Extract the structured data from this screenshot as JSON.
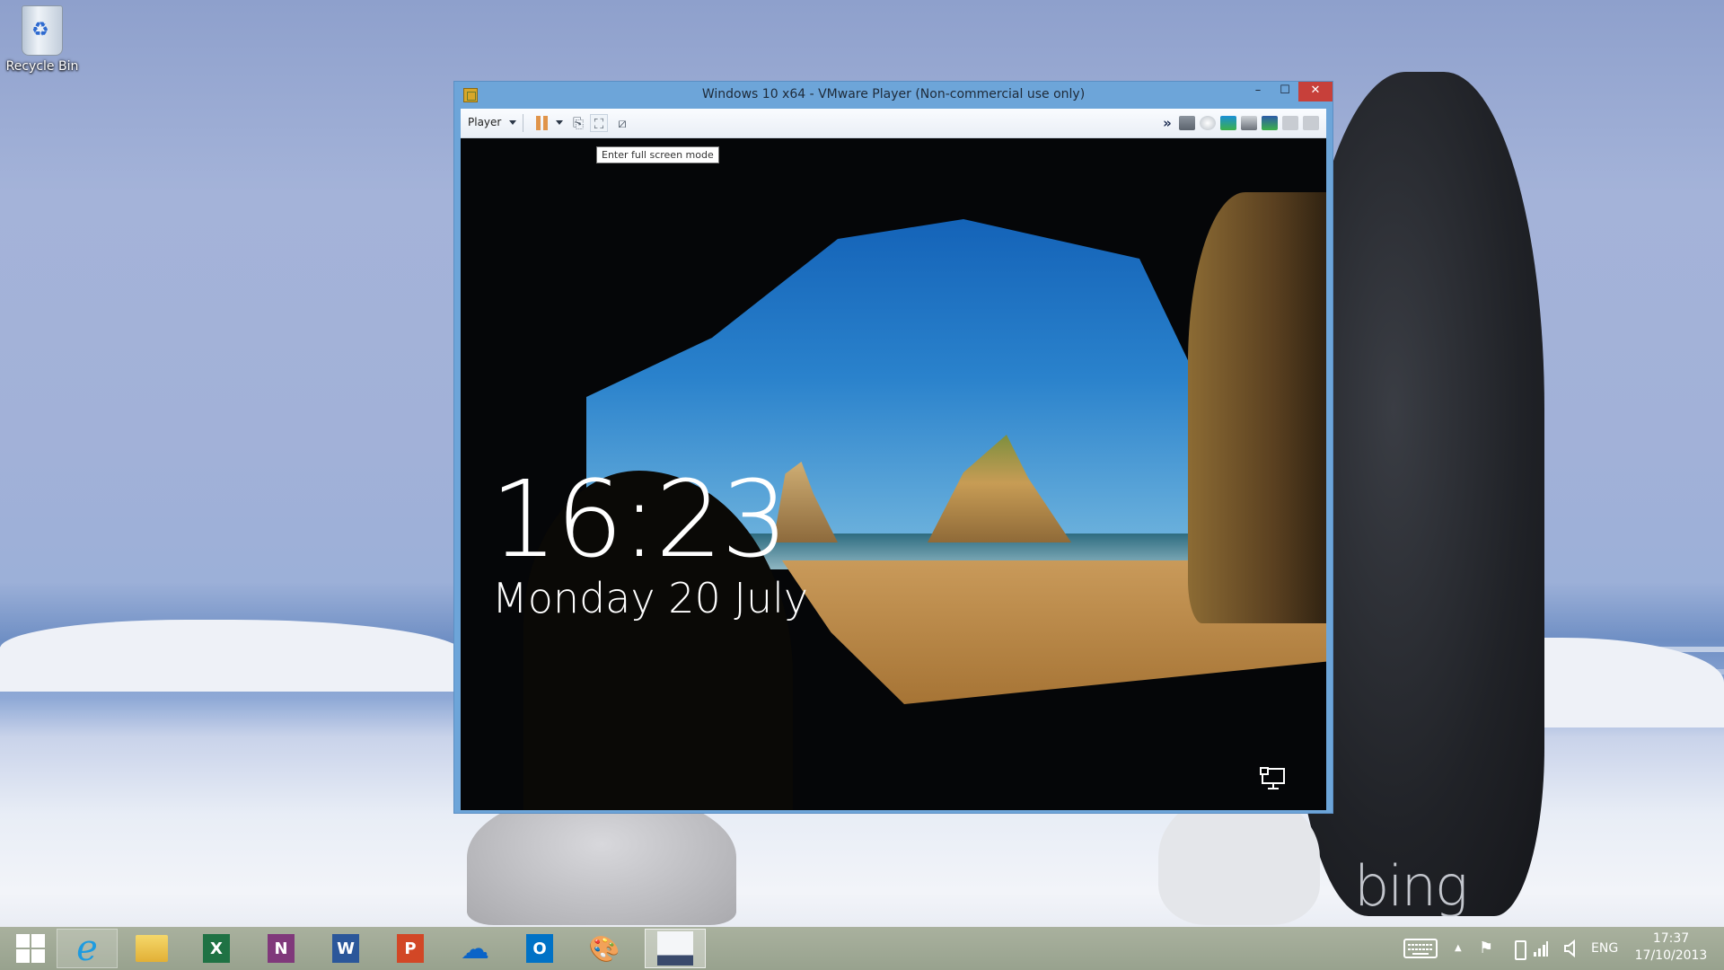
{
  "desktop": {
    "icons": [
      {
        "label": "Recycle Bin",
        "icon": "recycle-bin-icon"
      }
    ],
    "watermark": "bing"
  },
  "window": {
    "title": "Windows 10 x64 - VMware Player (Non-commercial use only)",
    "controls": {
      "minimize": "–",
      "maximize": "☐",
      "close": "✕"
    },
    "toolbar": {
      "player_menu": "Player",
      "tooltip": "Enter full screen mode",
      "overflow": "»",
      "buttons": [
        "pause",
        "pause-menu",
        "send-ctrl-alt-del",
        "full-screen",
        "unity"
      ],
      "devices": [
        "hard-disk",
        "cd-dvd",
        "network-adapter",
        "printer",
        "sound-card",
        "removable-device-1",
        "removable-device-2",
        "keyboard",
        "camera"
      ]
    }
  },
  "vm_screen": {
    "time": "16:23",
    "date": "Monday 20 July",
    "network_icon": "network-icon"
  },
  "taskbar": {
    "start": "start-button",
    "pinned": [
      {
        "name": "internet-explorer",
        "glyph": "e",
        "color": "#1e9be0"
      },
      {
        "name": "file-explorer",
        "glyph": "",
        "color": "#f0c63c"
      },
      {
        "name": "excel",
        "glyph": "X",
        "color": "#1f7244"
      },
      {
        "name": "onenote",
        "glyph": "N",
        "color": "#80397b"
      },
      {
        "name": "word",
        "glyph": "W",
        "color": "#2b579a"
      },
      {
        "name": "powerpoint",
        "glyph": "P",
        "color": "#d24726"
      },
      {
        "name": "onedrive",
        "glyph": "☁",
        "color": "#0a64c8"
      },
      {
        "name": "outlook",
        "glyph": "O",
        "color": "#0072c6"
      },
      {
        "name": "paint",
        "glyph": "🎨",
        "color": "#e8c070"
      },
      {
        "name": "vmware-player",
        "glyph": "",
        "color": "#ffffff"
      }
    ],
    "tray": {
      "keyboard": "touch-keyboard-icon",
      "show_hidden": "▲",
      "language": "ENG",
      "time": "17:37",
      "date": "17/10/2013"
    }
  }
}
